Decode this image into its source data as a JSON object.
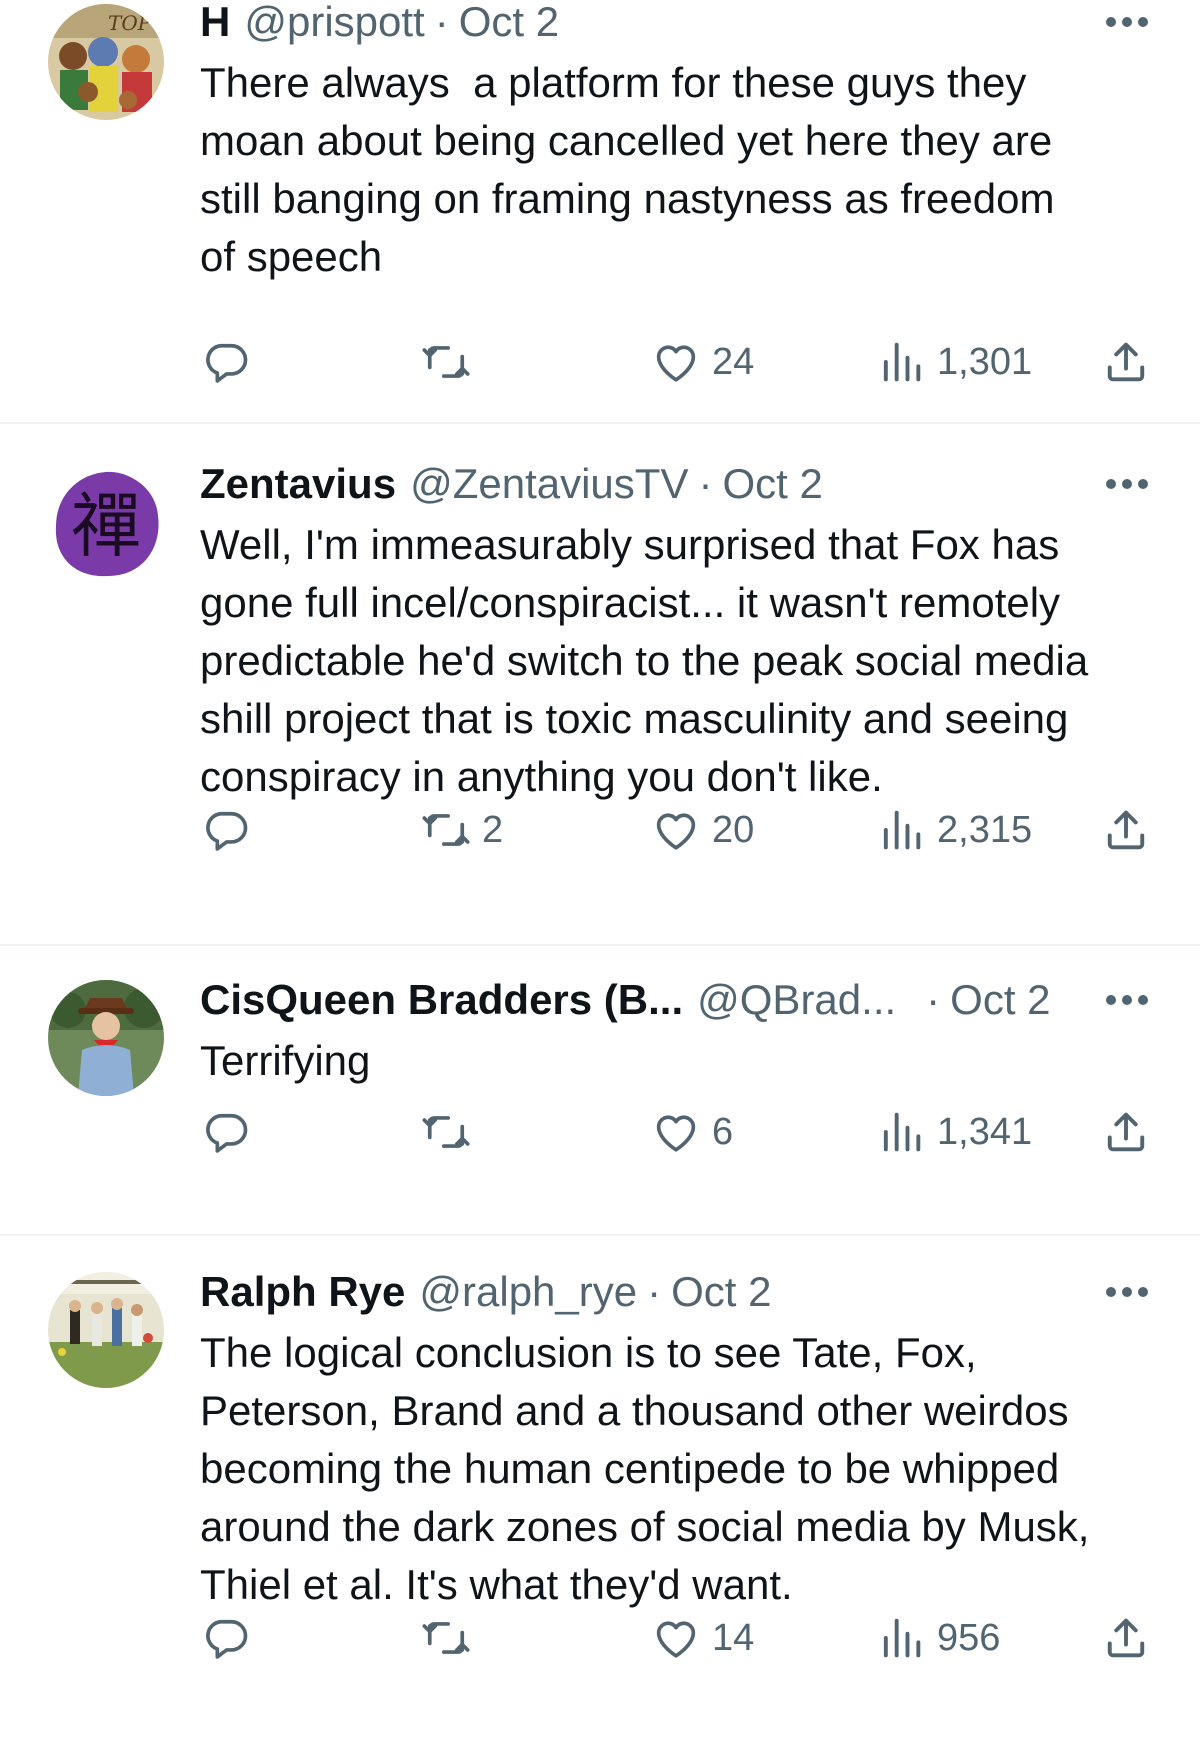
{
  "colors": {
    "text": "#0f1419",
    "secondary": "#536471",
    "divider": "#eff3f4"
  },
  "icons": {
    "reply": "speech-bubble-icon",
    "retweet": "retweet-arrows-icon",
    "like": "heart-icon",
    "views": "bar-chart-icon",
    "share": "upload-arrow-icon",
    "more": "three-dots-icon"
  },
  "tweets": [
    {
      "display_name": "H",
      "handle": "@prispott",
      "separator": "·",
      "date": "Oct 2",
      "text": "There always  a platform for these guys they\nmoan about being cancelled yet here they are\nstill banging on framing nastyness as freedom\nof speech",
      "replies": "",
      "retweets": "",
      "likes": "24",
      "views": "1,301"
    },
    {
      "display_name": "Zentavius",
      "handle": "@ZentaviusTV",
      "separator": "·",
      "date": "Oct 2",
      "text": "Well, I'm immeasurably surprised that Fox has\ngone full incel/conspiracist... it wasn't remotely\npredictable he'd switch to the peak social media\nshill project that is toxic masculinity and seeing\nconspiracy in anything you don't like.",
      "replies": "",
      "retweets": "2",
      "likes": "20",
      "views": "2,315"
    },
    {
      "display_name": "CisQueen Bradders (B...",
      "handle": "@QBrad...",
      "separator": "·",
      "date": "Oct 2",
      "text": "Terrifying",
      "replies": "",
      "retweets": "",
      "likes": "6",
      "views": "1,341"
    },
    {
      "display_name": "Ralph Rye",
      "handle": "@ralph_rye",
      "separator": "·",
      "date": "Oct 2",
      "text": "The logical conclusion is to see Tate, Fox,\nPeterson, Brand and a thousand other weirdos\nbecoming the human centipede to be whipped\naround the dark zones of social media by Musk,\nThiel et al. It's what they'd want.",
      "replies": "",
      "retweets": "",
      "likes": "14",
      "views": "956"
    }
  ]
}
